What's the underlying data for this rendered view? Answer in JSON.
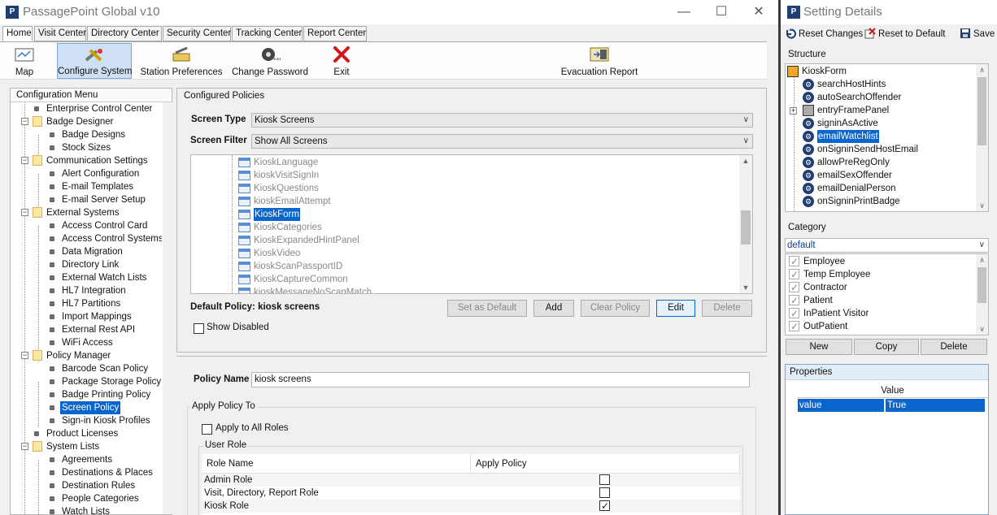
{
  "main_window": {
    "title": "PassagePoint Global v10",
    "controls": {
      "minimize": "—",
      "maximize": "☐",
      "close": "✕"
    }
  },
  "menu_tabs": [
    "Home",
    "Visit Center",
    "Directory Center",
    "Security Center",
    "Tracking Center",
    "Report Center"
  ],
  "toolbar": {
    "map": "Map",
    "configure_system": "Configure System",
    "station_preferences": "Station Preferences",
    "change_password": "Change Password",
    "exit": "Exit",
    "evacuation_report": "Evacuation Report"
  },
  "config_menu": {
    "header": "Configuration Menu",
    "items": [
      "Enterprise Control Center",
      "Badge Designer",
      "Badge Designs",
      "Stock Sizes",
      "Communication Settings",
      "Alert Configuration",
      "E-mail Templates",
      "E-mail Server Setup",
      "External Systems",
      "Access Control Card",
      "Access Control Systems",
      "Data Migration",
      "Directory Link",
      "External Watch Lists",
      "HL7 Integration",
      "HL7 Partitions",
      "Import Mappings",
      "External Rest API",
      "WiFi Access",
      "Policy Manager",
      "Barcode Scan Policy",
      "Package Storage Policy",
      "Badge Printing Policy",
      "Screen Policy",
      "Sign-in Kiosk Profiles",
      "Product Licenses",
      "System Lists",
      "Agreements",
      "Destinations & Places",
      "Destination Rules",
      "People Categories",
      "Watch Lists"
    ]
  },
  "configured_policies": {
    "title": "Configured Policies",
    "screen_type_label": "Screen Type",
    "screen_type_value": "Kiosk Screens",
    "screen_filter_label": "Screen Filter",
    "screen_filter_value": "Show All Screens",
    "screens": [
      "KioskLanguage",
      "kioskVisitSignIn",
      "KioskQuestions",
      "kioskEmailAttempt",
      "KioskForm",
      "KioskCategories",
      "KioskExpandedHintPanel",
      "KioskVideo",
      "kioskScanPassportID",
      "KioskCaptureCommon",
      "kioskMessageNoScanMatch"
    ],
    "default_policy": "Default Policy: kiosk screens",
    "buttons": {
      "set_default": "Set as Default",
      "add": "Add",
      "clear_policy": "Clear Policy",
      "edit": "Edit",
      "delete": "Delete"
    },
    "show_disabled": "Show Disabled"
  },
  "policy_detail": {
    "policy_name_label": "Policy Name",
    "policy_name_value": "kiosk screens",
    "apply_to_label": "Apply Policy To",
    "apply_all_roles": "Apply to All Roles",
    "user_role_label": "User Role",
    "columns": [
      "Role Name",
      "Apply Policy"
    ],
    "roles": [
      {
        "name": "Admin Role",
        "applied": false
      },
      {
        "name": "Visit, Directory, Report Role",
        "applied": false
      },
      {
        "name": "Kiosk Role",
        "applied": true
      }
    ]
  },
  "settings_window": {
    "title": "Setting Details",
    "toolbar": {
      "reset_changes": "Reset Changes",
      "reset_default": "Reset to Default",
      "save": "Save"
    },
    "structure_label": "Structure",
    "structure_root": "KioskForm",
    "structure_items": [
      "searchHostHints",
      "autoSearchOffender",
      "entryFramePanel",
      "signinAsActive",
      "emailWatchlist",
      "onSigninSendHostEmail",
      "allowPreRegOnly",
      "emailSexOffender",
      "emailDenialPerson",
      "onSigninPrintBadge"
    ],
    "category_label": "Category",
    "category_value": "default",
    "categories": [
      "Employee",
      "Temp Employee",
      "Contractor",
      "Patient",
      "InPatient Visitor",
      "OutPatient"
    ],
    "category_buttons": {
      "new": "New",
      "copy": "Copy",
      "delete": "Delete"
    },
    "properties_label": "Properties",
    "properties_value_header": "Value",
    "property_row": {
      "name": "value",
      "value": "True"
    }
  }
}
